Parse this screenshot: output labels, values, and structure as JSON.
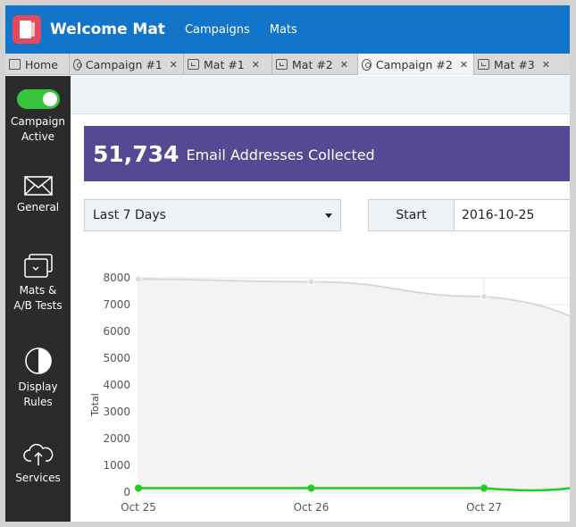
{
  "header": {
    "app_title": "Welcome Mat",
    "nav": [
      "Campaigns",
      "Mats"
    ]
  },
  "tabs": [
    {
      "label": "Home",
      "icon": "mail-icon",
      "closable": false,
      "active": false
    },
    {
      "label": "Campaign #1",
      "icon": "target-icon",
      "closable": true,
      "active": false
    },
    {
      "label": "Mat #1",
      "icon": "mat-icon",
      "closable": true,
      "active": false
    },
    {
      "label": "Mat #2",
      "icon": "mat-icon",
      "closable": true,
      "active": false
    },
    {
      "label": "Campaign #2",
      "icon": "target-icon",
      "closable": true,
      "active": true
    },
    {
      "label": "Mat #3",
      "icon": "mat-icon",
      "closable": true,
      "active": false
    }
  ],
  "sidebar": {
    "toggle_label_1": "Campaign",
    "toggle_label_2": "Active",
    "toggle_on": true,
    "items": [
      {
        "line1": "General",
        "line2": "",
        "icon": "envelope-icon"
      },
      {
        "line1": "Mats &",
        "line2": "A/B Tests",
        "icon": "mats-icon"
      },
      {
        "line1": "Display",
        "line2": "Rules",
        "icon": "contrast-icon"
      },
      {
        "line1": "Services",
        "line2": "",
        "icon": "cloud-upload-icon"
      }
    ]
  },
  "stats": {
    "count": "51,734",
    "label": "Email Addresses Collected"
  },
  "filters": {
    "range_selected": "Last 7 Days",
    "start_label": "Start",
    "start_value": "2016-10-25"
  },
  "colors": {
    "header": "#1275c9",
    "banner": "#534a93",
    "toggle": "#35c43b",
    "sidebar": "#2b2b2b",
    "series_total": "#d8d8d8",
    "series_green": "#22cc22"
  },
  "chart_data": {
    "type": "line",
    "xlabel": "",
    "ylabel": "Total",
    "ylim": [
      0,
      8000
    ],
    "yticks": [
      0,
      1000,
      2000,
      3000,
      4000,
      5000,
      6000,
      7000,
      8000
    ],
    "categories": [
      "Oct 25",
      "Oct 26",
      "Oct 27"
    ],
    "grid": true,
    "series": [
      {
        "values": [
          7950,
          7850,
          7300
        ],
        "color": "#d8d8d8",
        "fill": true
      },
      {
        "values": [
          150,
          150,
          150
        ],
        "color": "#22cc22",
        "fill": false
      }
    ]
  }
}
